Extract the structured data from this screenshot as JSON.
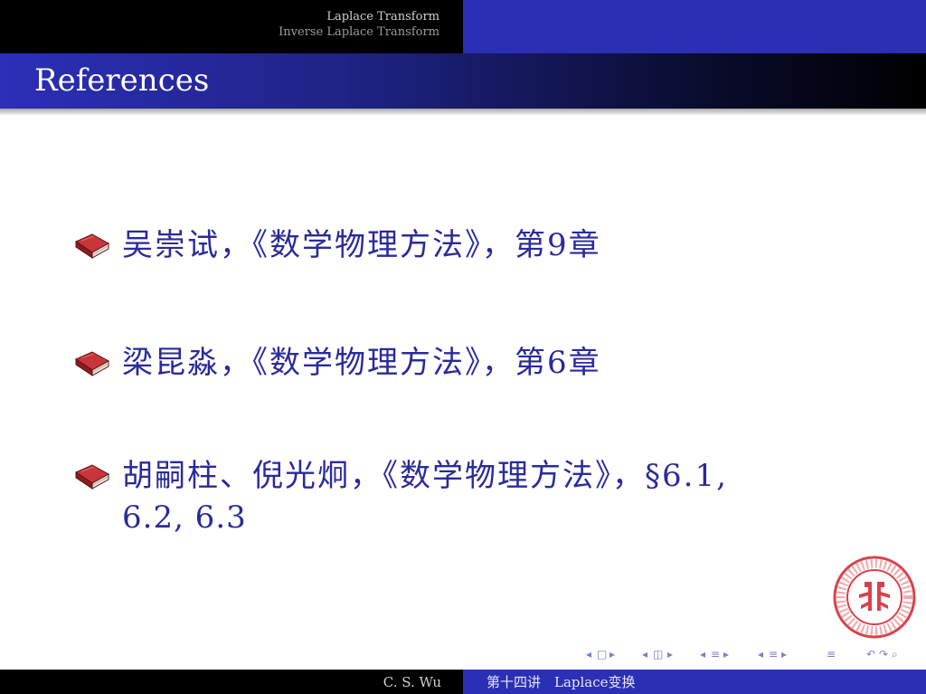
{
  "header": {
    "sections": [
      "Laplace Transform",
      "Inverse Laplace Transform"
    ]
  },
  "frame": {
    "title": "References"
  },
  "references": [
    {
      "text": "吴崇试，《数学物理方法》，第9章"
    },
    {
      "text": "梁昆淼，《数学物理方法》，第6章"
    },
    {
      "text": "胡嗣柱、倪光炯，《数学物理方法》，§6.1,",
      "continuation": "6.2, 6.3"
    }
  ],
  "footer": {
    "author": "C. S. Wu",
    "title": "第十四讲　Laplace变换"
  },
  "icons": {
    "bullet": "book-icon",
    "logo": "peking-university-seal-icon"
  },
  "colors": {
    "accent": "#2b2fb3",
    "text": "#2a2a9c",
    "book": "#b8262b",
    "logo": "#d8424c"
  }
}
